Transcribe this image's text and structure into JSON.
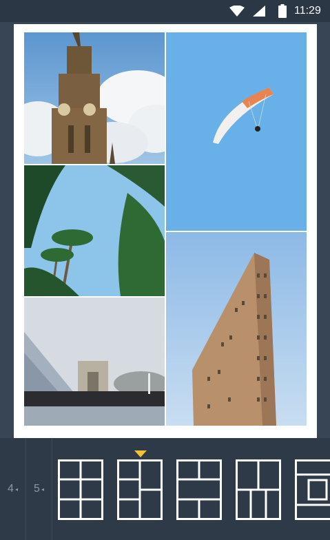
{
  "status_bar": {
    "time": "11:29",
    "icons": [
      "wifi-icon",
      "signal-icon",
      "battery-icon"
    ]
  },
  "collage": {
    "photos": [
      {
        "name": "photo-cathedral-tower",
        "subject": "cathedral-tower"
      },
      {
        "name": "photo-paraglider",
        "subject": "paraglider"
      },
      {
        "name": "photo-palm-trees",
        "subject": "palm-trees"
      },
      {
        "name": "photo-louvre-pyramid",
        "subject": "louvre-pyramid"
      },
      {
        "name": "photo-flatiron-building",
        "subject": "flatiron-building"
      }
    ]
  },
  "bottom_bar": {
    "photo_counts": [
      {
        "label": "4",
        "arrow": "◂"
      },
      {
        "label": "5",
        "arrow": "◂"
      }
    ],
    "selected_layout_index": 1,
    "layout_count_visible": 5
  },
  "colors": {
    "background": "#3a4758",
    "status_bar": "#2c3746",
    "bottom_bar": "#2f3a49",
    "layout_outline": "#ffffff",
    "selection_marker": "#f2c230",
    "count_text": "#8d97a5"
  }
}
